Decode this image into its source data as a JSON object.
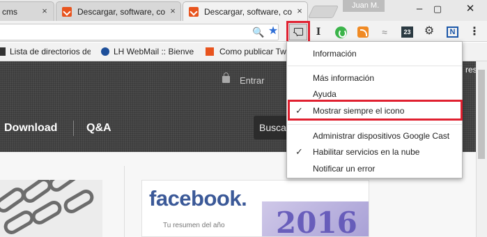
{
  "tabs": [
    {
      "title": "cms",
      "close": "×"
    },
    {
      "title": "Descargar, software, co",
      "close": "×"
    },
    {
      "title": "Descargar, software, co",
      "close": "×",
      "active": true
    }
  ],
  "window": {
    "user": "Juan M.",
    "minimize": "–",
    "maximize": "▢",
    "close": "✕"
  },
  "toolbar": {
    "zoom_icon": "🔍",
    "star_icon": "★",
    "italic_ext": "I",
    "calendar_ext": "23",
    "gear_icon": "⚙",
    "n_ext": "N",
    "menu_icon": "⋮"
  },
  "bookmarks": [
    {
      "label": "Lista de directorios de"
    },
    {
      "label": "LH WebMail :: Bienver"
    },
    {
      "label": "Como publicar Tw"
    }
  ],
  "page": {
    "nav": [
      "Download",
      "Q&A"
    ],
    "entrar": "Entrar",
    "search": "Busca",
    "right_fragment": "res",
    "facebook_word": "facebook.",
    "facebook_sub": "Tu resumen del año",
    "facebook_year": "2016"
  },
  "menu": {
    "items": [
      {
        "label": "Información",
        "checked": false
      },
      {
        "label": "Más información",
        "checked": false
      },
      {
        "label": "Ayuda",
        "checked": false
      },
      {
        "label": "Mostrar siempre el icono",
        "checked": true
      },
      {
        "label": "Administrar dispositivos Google Cast",
        "checked": false
      },
      {
        "label": "Habilitar servicios en la nube",
        "checked": true
      },
      {
        "label": "Notificar un error",
        "checked": false
      }
    ],
    "check_glyph": "✓"
  },
  "colors": {
    "highlight": "#e02030",
    "facebook": "#3b5998",
    "accent_tab_icon": "#e8541e"
  }
}
